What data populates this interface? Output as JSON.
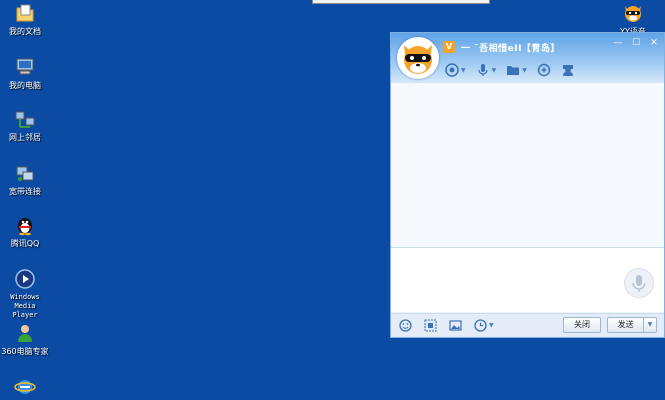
{
  "desktop": {
    "icons": [
      {
        "label": "我的文档",
        "icon": "folder-document-icon"
      },
      {
        "label": "我的电脑",
        "icon": "computer-icon"
      },
      {
        "label": "网上邻居",
        "icon": "network-icon"
      },
      {
        "label": "宽带连接",
        "icon": "broadband-icon"
      },
      {
        "label": "腾讯QQ",
        "icon": "qq-penguin-icon"
      },
      {
        "label": "Windows\nMedia Player",
        "icon": "media-player-icon"
      },
      {
        "label": "360电脑专家",
        "icon": "360-expert-icon"
      },
      {
        "label": "",
        "icon": "internet-explorer-icon"
      },
      {
        "label": "YY语音",
        "icon": "yy-voice-icon"
      }
    ]
  },
  "chat": {
    "title": "一   ˜吾相惜eII【青岛】",
    "badge": "V",
    "controls": {
      "minimize": "—",
      "maximize": "☐",
      "close": "✕"
    },
    "buttons": {
      "close": "关闭",
      "send": "发送",
      "send_menu": "▼"
    },
    "caret": "▼"
  },
  "colors": {
    "desktop": "#0c4ba3",
    "header": "#5ea3e6",
    "accent": "#4a7fbf"
  }
}
